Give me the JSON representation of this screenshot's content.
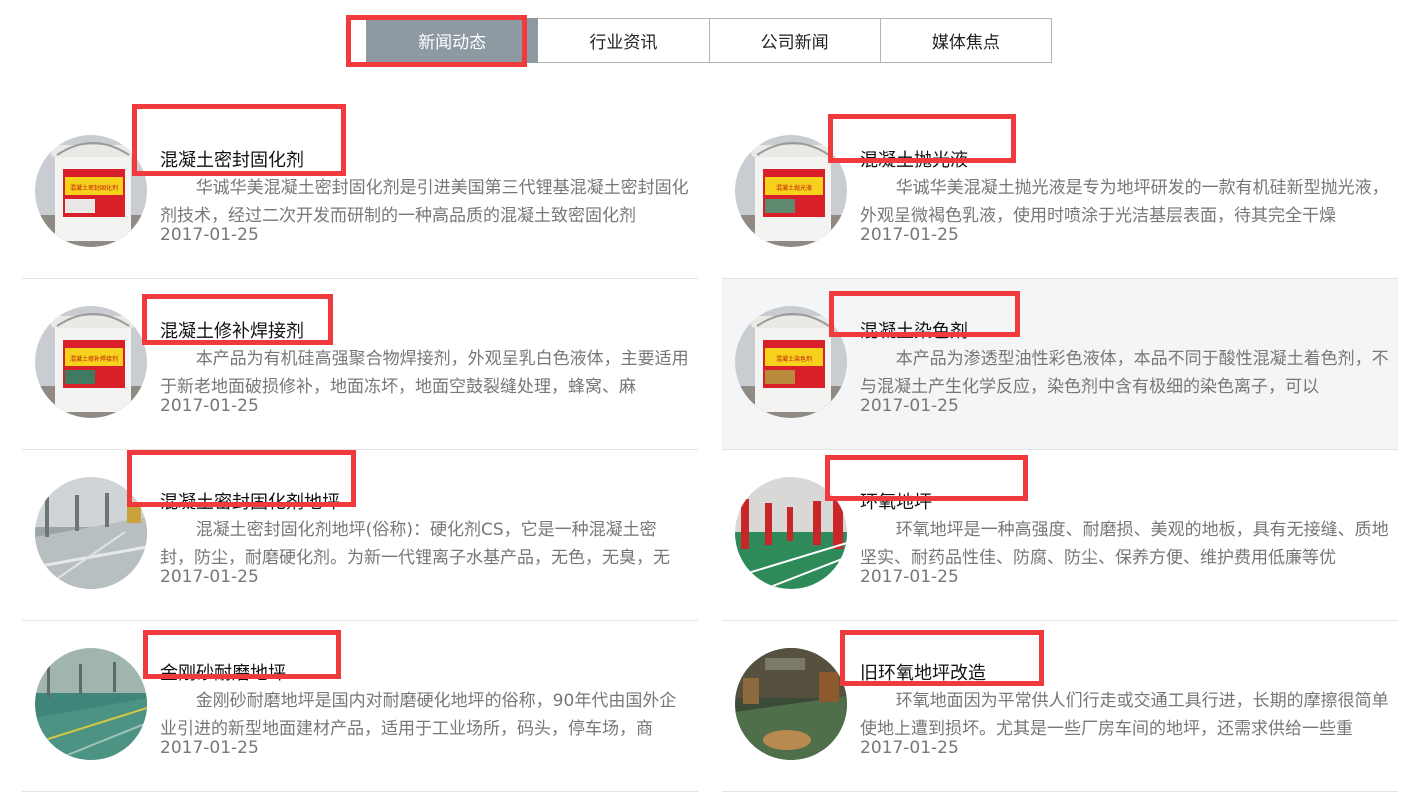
{
  "tabs": [
    {
      "label": "新闻动态",
      "active": true
    },
    {
      "label": "行业资讯",
      "active": false
    },
    {
      "label": "公司新闻",
      "active": false
    },
    {
      "label": "媒体焦点",
      "active": false
    }
  ],
  "articles": [
    {
      "title": "混凝土密封固化剂",
      "summary": "华诚华美混凝土密封固化剂是引进美国第三代锂基混凝土密封固化剂技术，经过二次开发而研制的一种高品质的混凝土致密固化剂",
      "date": "2017-01-25",
      "image": "bucket",
      "bucket_label": "混凝土密封固化剂"
    },
    {
      "title": "混凝土抛光液",
      "summary": "华诚华美混凝土抛光液是专为地坪研发的一款有机硅新型抛光液，外观呈微褐色乳液，使用时喷涂于光洁基层表面，待其完全干燥",
      "date": "2017-01-25",
      "image": "bucket",
      "bucket_label": "混凝土抛光液"
    },
    {
      "title": "混凝土修补焊接剂",
      "summary": "本产品为有机硅高强聚合物焊接剂，外观呈乳白色液体，主要适用于新老地面破损修补，地面冻坏，地面空鼓裂缝处理，蜂窝、麻",
      "date": "2017-01-25",
      "image": "bucket",
      "bucket_label": "混凝土修补焊接剂"
    },
    {
      "title": "混凝土染色剂",
      "summary": "本产品为渗透型油性彩色液体，本品不同于酸性混凝土着色剂，不与混凝土产生化学反应，染色剂中含有极细的染色离子，可以",
      "date": "2017-01-25",
      "image": "bucket",
      "bucket_label": "混凝土染色剂"
    },
    {
      "title": "混凝土密封固化剂地坪",
      "summary": "混凝土密封固化剂地坪(俗称)：硬化剂CS，它是一种混凝土密封，防尘，耐磨硬化剂。为新一代锂离子水基产品，无色，无臭，无",
      "date": "2017-01-25",
      "image": "floor-grey"
    },
    {
      "title": "环氧地坪",
      "summary": "环氧地坪是一种高强度、耐磨损、美观的地板，具有无接缝、质地坚实、耐药品性佳、防腐、防尘、保养方便、维护费用低廉等优",
      "date": "2017-01-25",
      "image": "floor-green-red"
    },
    {
      "title": "金刚砂耐磨地坪",
      "summary": "金刚砂耐磨地坪是国内对耐磨硬化地坪的俗称，90年代由国外企业引进的新型地面建材产品，适用于工业场所，码头，停车场，商",
      "date": "2017-01-25",
      "image": "floor-green"
    },
    {
      "title": "旧环氧地坪改造",
      "summary": "环氧地面因为平常供人们行走或交通工具行进，长期的摩擦很简单使地上遭到损坏。尤其是一些厂房车间的地坪，还需求供给一些重",
      "date": "2017-01-25",
      "image": "floor-old"
    }
  ]
}
